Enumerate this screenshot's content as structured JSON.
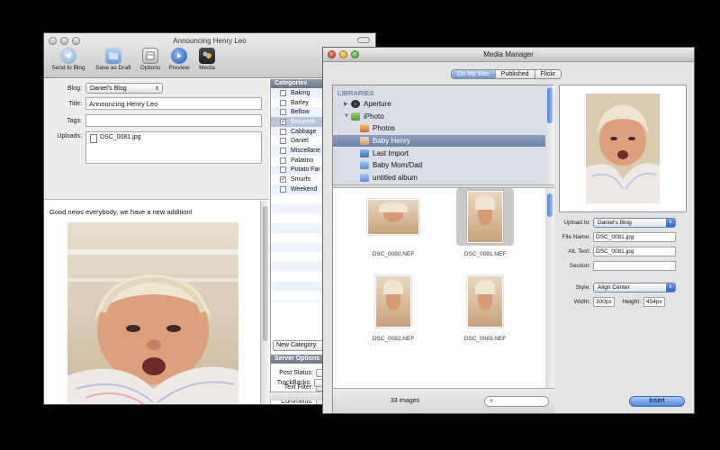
{
  "editor": {
    "title": "Announcing Henry Leo",
    "toolbar": [
      {
        "label": "Send to Blog",
        "icon": "send-icon"
      },
      {
        "label": "Save as Draft",
        "icon": "folder-icon"
      },
      {
        "label": "Options",
        "icon": "options-icon"
      },
      {
        "label": "Preview",
        "icon": "play-icon"
      },
      {
        "label": "Media",
        "icon": "media-icon"
      }
    ],
    "form": {
      "blog_label": "Blog:",
      "blog_value": "Daniel's Blog",
      "title_label": "Title:",
      "title_value": "Announcing Henry Leo",
      "tags_label": "Tags:",
      "tags_value": "",
      "uploads_label": "Uploads:",
      "upload_file": "DSC_0081.jpg"
    },
    "body_text": "Good news everybody, we have a new addition!",
    "categories": {
      "header": "Categories",
      "items": [
        {
          "label": "Baking",
          "checked": false
        },
        {
          "label": "Barley",
          "checked": false
        },
        {
          "label": "Bellow",
          "checked": false
        },
        {
          "label": "Booyeah",
          "checked": true
        },
        {
          "label": "Cabbage",
          "checked": false
        },
        {
          "label": "Daniel",
          "checked": false
        },
        {
          "label": "Miscellane",
          "checked": false
        },
        {
          "label": "Palatino",
          "checked": false
        },
        {
          "label": "Potato Far",
          "checked": false
        },
        {
          "label": "Smurfs",
          "checked": true
        },
        {
          "label": "Weekend",
          "checked": false
        }
      ],
      "new_category": "New Category"
    },
    "server_options": {
      "header": "Server Options",
      "post_status_label": "Post Status:",
      "text_filter_label": "Text Filter:",
      "comments_label": "Comments:",
      "trackbacks_label": "TrackBacks:"
    }
  },
  "media_manager": {
    "title": "Media Manager",
    "tabs": [
      {
        "label": "On My Mac",
        "active": true
      },
      {
        "label": "Published",
        "active": false
      },
      {
        "label": "Flickr",
        "active": false
      }
    ],
    "libraries": {
      "header": "LIBRARIES",
      "items": [
        {
          "label": "Aperture",
          "indent": 1,
          "icon": "aperture-icon",
          "expander": "▶"
        },
        {
          "label": "iPhoto",
          "indent": 1,
          "icon": "iphoto-icon",
          "expander": "▼"
        },
        {
          "label": "Photos",
          "indent": 2,
          "icon": "photos-icon"
        },
        {
          "label": "Baby Henry",
          "indent": 2,
          "icon": "event-icon",
          "selected": true
        },
        {
          "label": "Last Import",
          "indent": 2,
          "icon": "import-icon"
        },
        {
          "label": "Baby Mom/Dad",
          "indent": 2,
          "icon": "album-icon"
        },
        {
          "label": "untitled album",
          "indent": 2,
          "icon": "album-icon"
        }
      ]
    },
    "thumbnails": [
      {
        "name": "DSC_0080.NEF",
        "orientation": "landscape",
        "selected": false
      },
      {
        "name": "DSC_0081.NEF",
        "orientation": "portrait",
        "selected": true
      },
      {
        "name": "DSC_0082.NEF",
        "orientation": "portrait",
        "selected": false
      },
      {
        "name": "DSC_0083.NEF",
        "orientation": "portrait",
        "selected": false
      }
    ],
    "image_count": "33 images",
    "search_placeholder": "",
    "details": {
      "upload_to_label": "Upload to:",
      "upload_to_value": "Daniel's Blog",
      "file_name_label": "File Name:",
      "file_name_value": "DSC_0081.jpg",
      "alt_text_label": "Alt. Text:",
      "alt_text_value": "DSC_0081.jpg",
      "section_label": "Section:",
      "section_value": "",
      "style_label": "Style:",
      "style_value": "Align Center",
      "width_label": "Width:",
      "width_value": "300px",
      "height_label": "Height:",
      "height_value": "454px"
    },
    "insert_label": "Insert"
  },
  "colors": {
    "selection_blue": "#7086aa",
    "accent_blue": "#4c87e0",
    "sidebar_bg": "#d8dde6"
  }
}
